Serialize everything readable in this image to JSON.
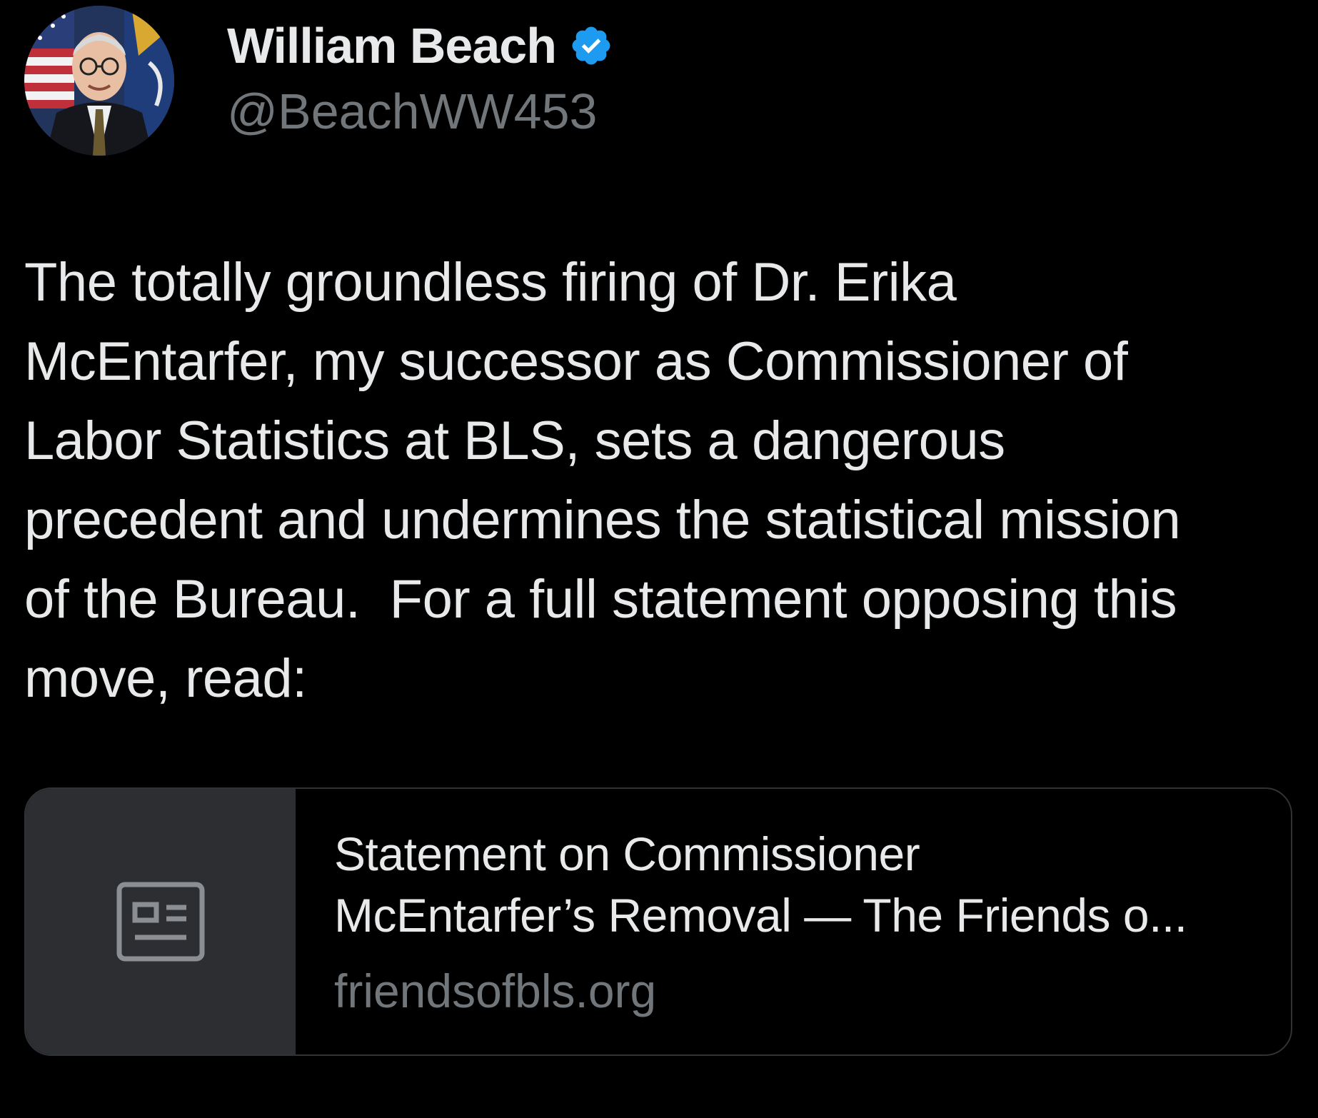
{
  "author": {
    "display_name": "William Beach",
    "handle": "@BeachWW453",
    "verified": true,
    "avatar_icon": "profile-photo"
  },
  "tweet": {
    "text_lines": [
      "The totally groundless firing of Dr. Erika",
      "McEntarfer, my successor as Commissioner of",
      "Labor Statistics at BLS, sets a dangerous",
      "precedent and undermines the statistical mission",
      "of the Bureau.  For a full statement opposing this",
      "move, read:"
    ]
  },
  "link_card": {
    "icon": "article-icon",
    "title_line1": "Statement on Commissioner",
    "title_line2": "McEntarfer’s Removal — The Friends o...",
    "domain": "friendsofbls.org"
  },
  "colors": {
    "background": "#000000",
    "primary_text": "#e7e9ea",
    "secondary_text": "#71767b",
    "verified_blue": "#1d9bf0",
    "card_media_bg": "#2c2e31",
    "card_border": "#2f3336"
  }
}
